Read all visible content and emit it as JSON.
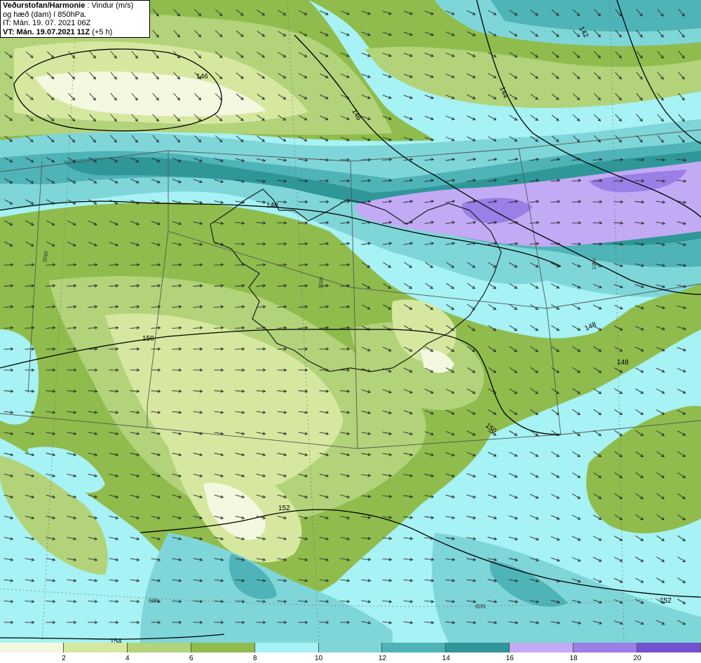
{
  "header": {
    "title": "Veðurstofan/Harmonie",
    "field": " : Vindur (m/s)",
    "subtitle": "og hæð (dam) í 850hPa.",
    "init_time": "IT: Mán. 19. 07. 2021 06Z",
    "valid_prefix": "VT: Mán. 19.07.2021 11Z",
    "valid_suffix": " (+5 h)"
  },
  "colors": {
    "wind_0_2": "#f4f8e0",
    "wind_2_4": "#d6e8a0",
    "wind_4_6": "#b2d37a",
    "wind_6_8": "#8fbc4d",
    "wind_8_10": "#a6f2f4",
    "wind_10_12": "#7fd6d8",
    "wind_12_14": "#4fb4b8",
    "wind_14_16": "#2f9798",
    "wind_16_18": "#c3aaf5",
    "wind_18_20": "#9b7ee6",
    "wind_20_plus": "#7452d0",
    "contour": "#000000",
    "grid": "#555555",
    "coast": "#1a1a1a"
  },
  "legend": {
    "ticks": [
      "2",
      "4",
      "6",
      "8",
      "10",
      "12",
      "14",
      "16",
      "18",
      "20"
    ],
    "bins": [
      "0–2",
      "2–4",
      "4–6",
      "6–8",
      "8–10",
      "10–12",
      "12–14",
      "14–16",
      "16–18",
      "18–20",
      "20+"
    ]
  },
  "contour_labels": [
    "142",
    "144",
    "146",
    "146",
    "148",
    "148",
    "148",
    "150",
    "150",
    "152",
    "152",
    "154"
  ],
  "graticule_labels": [
    "30W",
    "20W",
    "10W",
    "60N",
    "60N"
  ],
  "wind_arrow_direction": "mostly east-south-east"
}
